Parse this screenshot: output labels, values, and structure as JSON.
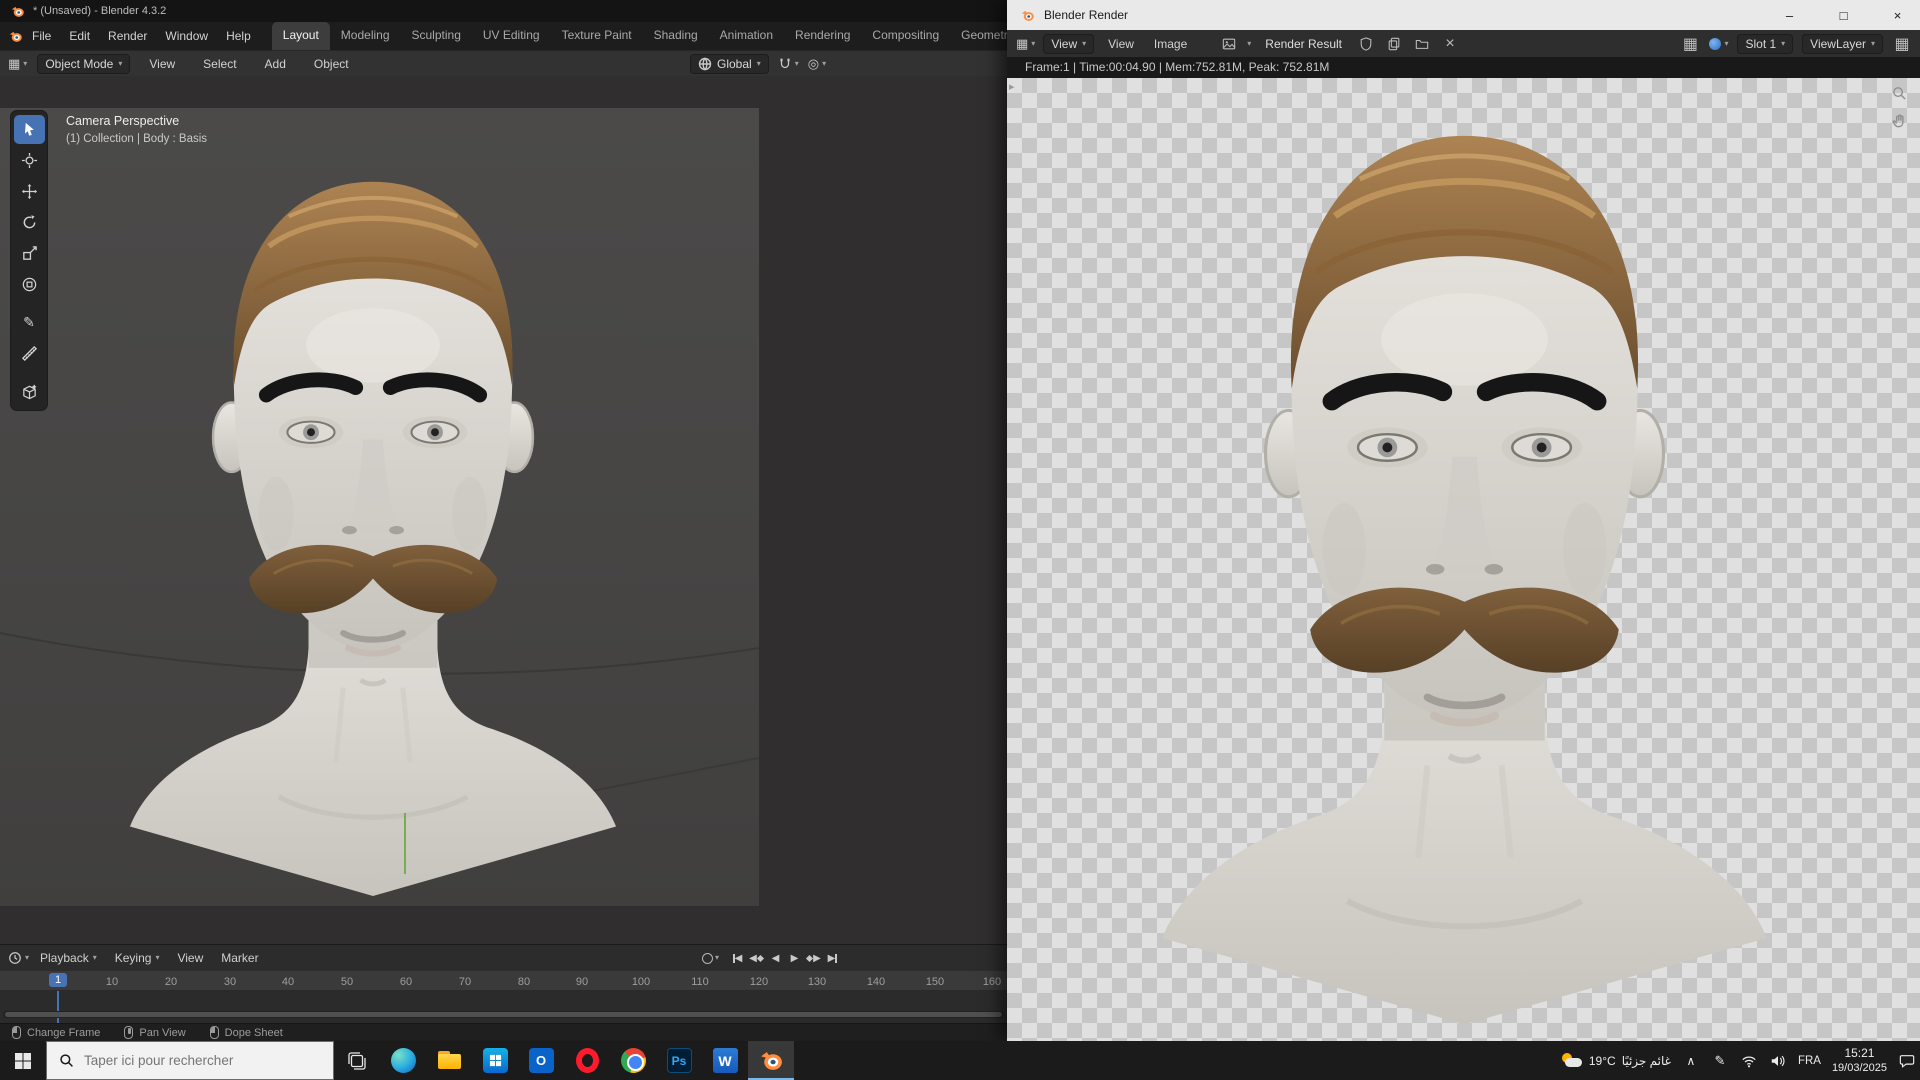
{
  "colors": {
    "accent_blue": "#4772b3",
    "blender_orange": "#ff8d3d",
    "taskbar_underline": "#76b9ed",
    "viewport_bg": "#464544",
    "checker_light": "#e0e0e0",
    "checker_dark": "#c6c6c6"
  },
  "icons": {
    "dropdown": "▾",
    "play": "▶",
    "rplay": "◀",
    "close": "×",
    "minimize": "–",
    "maximize": "□",
    "annotate": "✎",
    "propedit": "◎",
    "editor_grid": "▦",
    "chevron_up": "∧",
    "chevron_right": "▸",
    "x_small": "×"
  },
  "main_window": {
    "title": "* (Unsaved) - Blender 4.3.2",
    "menus": [
      "File",
      "Edit",
      "Render",
      "Window",
      "Help"
    ],
    "workspaces": [
      "Layout",
      "Modeling",
      "Sculpting",
      "UV Editing",
      "Texture Paint",
      "Shading",
      "Animation",
      "Rendering",
      "Compositing",
      "Geometry Nod"
    ],
    "tool_header": {
      "mode": "Object Mode",
      "menus": [
        "View",
        "Select",
        "Add",
        "Object"
      ],
      "orientation": "Global"
    },
    "viewport": {
      "overlay_line1": "Camera Perspective",
      "overlay_line2": "(1) Collection | Body : Basis"
    },
    "timeline": {
      "menus": [
        "Playback",
        "Keying",
        "View",
        "Marker"
      ],
      "current_frame": "1",
      "frames": [
        "10",
        "20",
        "30",
        "40",
        "50",
        "60",
        "70",
        "80",
        "90",
        "100",
        "110",
        "120",
        "130",
        "140",
        "150",
        "160"
      ]
    },
    "status_hints": [
      "Change Frame",
      "Pan View",
      "Dope Sheet"
    ]
  },
  "render_window": {
    "title": "Blender Render",
    "header": {
      "mode": "View",
      "menus": [
        "View",
        "Image"
      ],
      "image_name": "Render Result",
      "slot": "Slot 1",
      "view_layer": "ViewLayer"
    },
    "stats": "Frame:1 | Time:00:04.90 | Mem:752.81M, Peak: 752.81M"
  },
  "taskbar": {
    "search_placeholder": "Taper ici pour rechercher",
    "app_labels": {
      "photoshop": "Ps",
      "word": "W",
      "outlook": "O"
    },
    "tray": {
      "temperature": "19°C",
      "weather_desc": "غائم جزئيًا",
      "language": "FRA",
      "time": "15:21",
      "date": "19/03/2025"
    }
  }
}
